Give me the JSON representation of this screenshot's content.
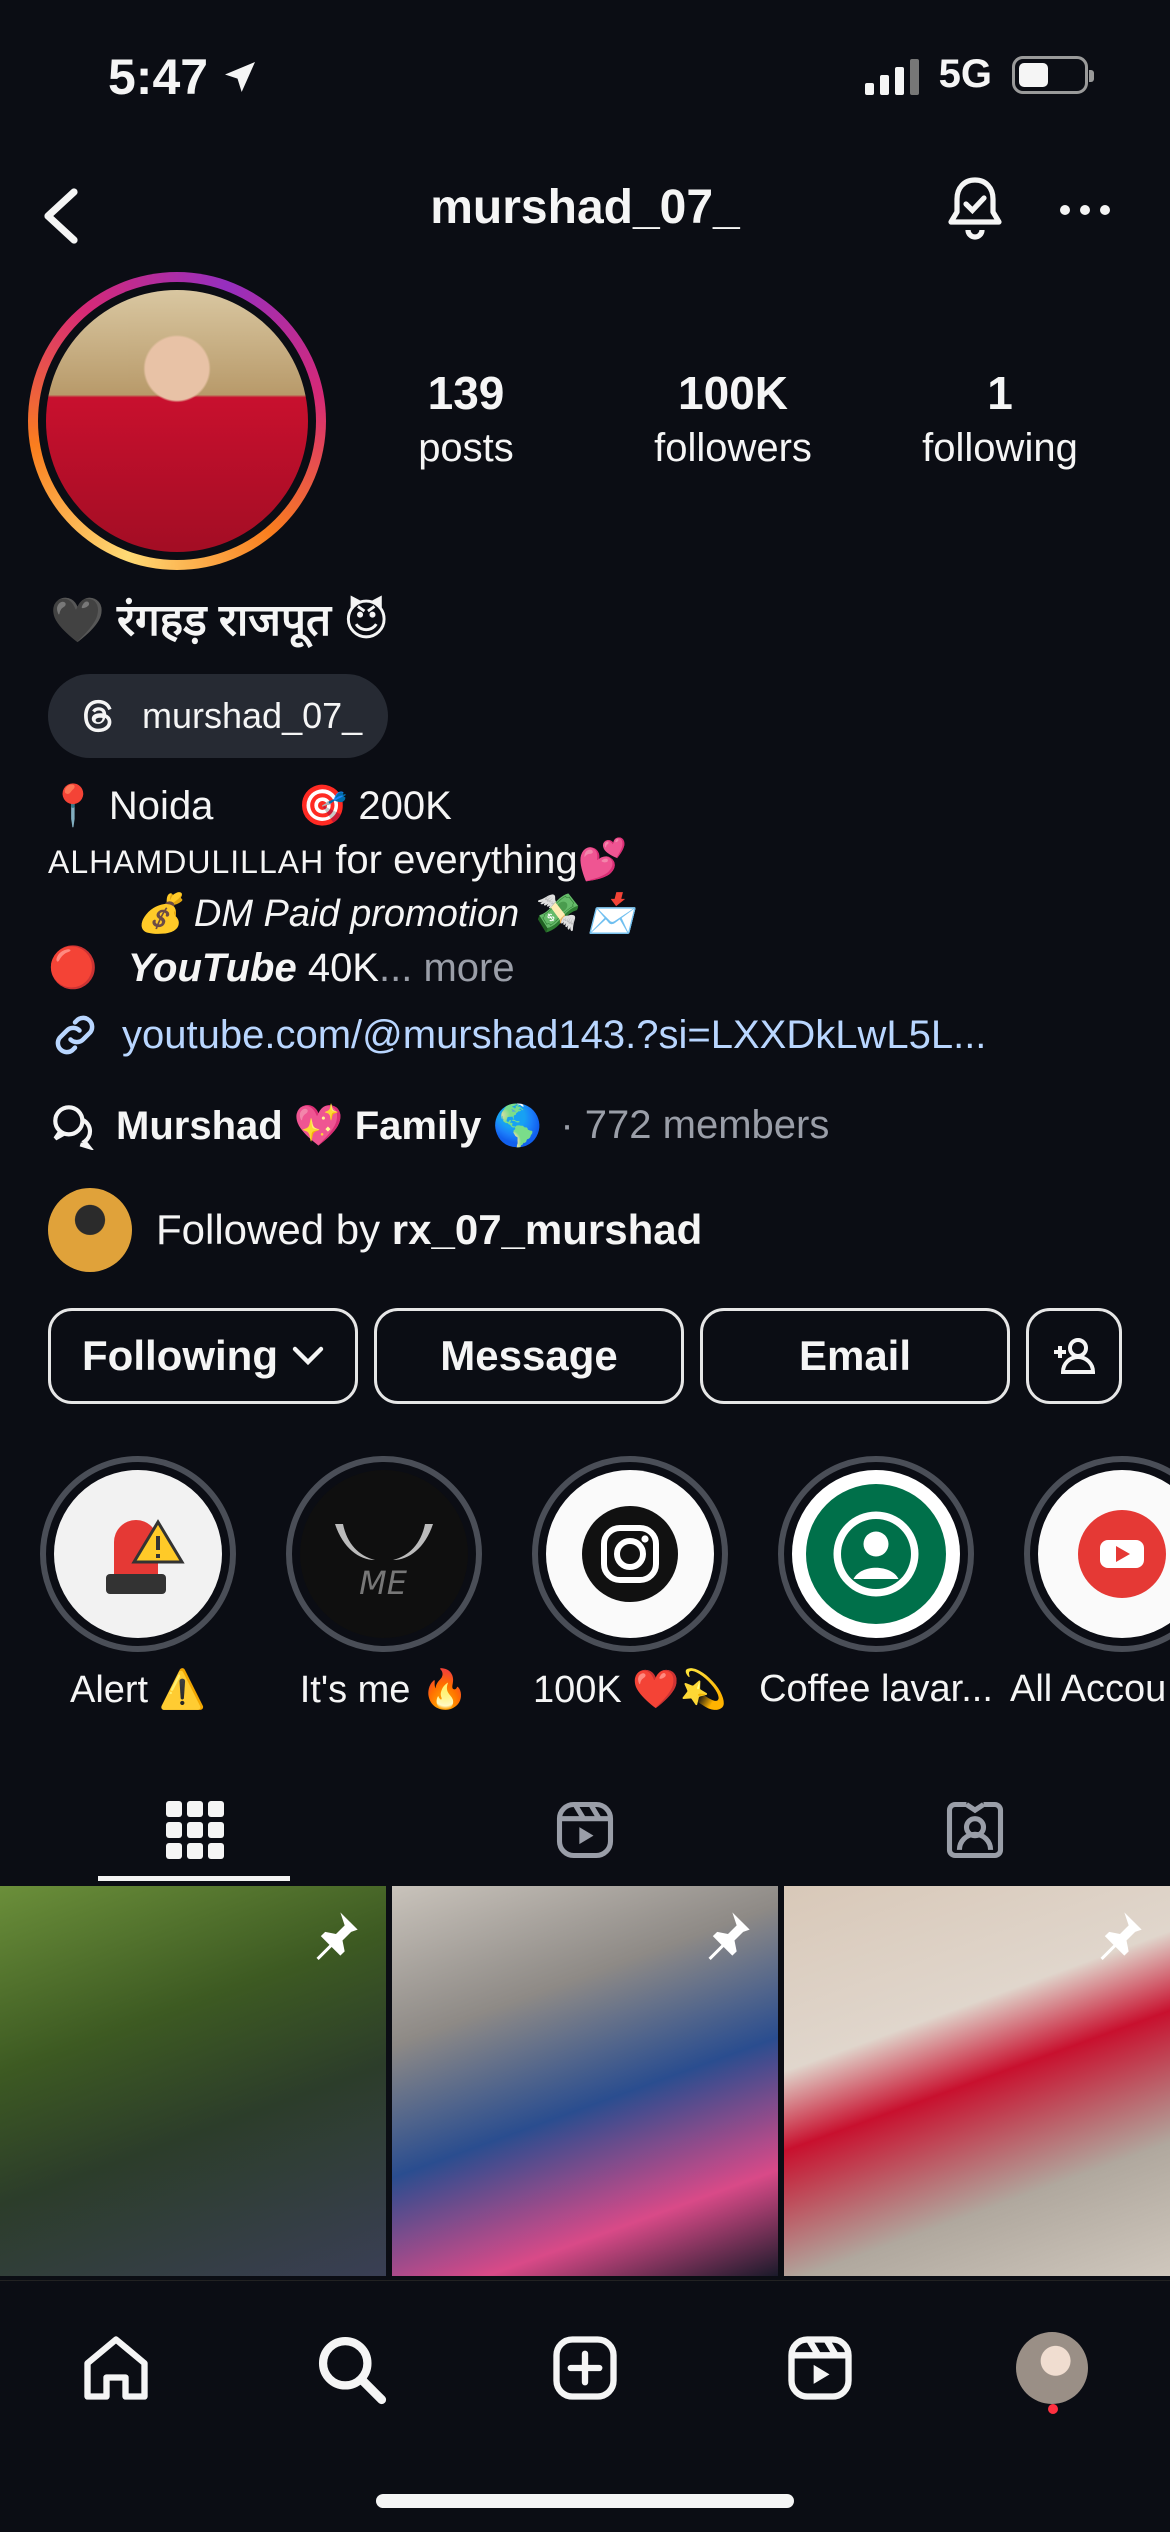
{
  "status_bar": {
    "time": "5:47",
    "network": "5G",
    "battery_level": 0.46
  },
  "header": {
    "username": "murshad_07_"
  },
  "stats": [
    {
      "number": "139",
      "label": "posts"
    },
    {
      "number": "100K",
      "label": "followers"
    },
    {
      "number": "1",
      "label": "following"
    }
  ],
  "profile": {
    "display_name": "🖤 रंगहड़ राजपूत 😈",
    "threads_handle": "murshad_07_",
    "bio_location": "📍 Noida",
    "bio_target": "🎯 200K",
    "bio_line2_caps": "ALHAMDULILLAH",
    "bio_line2_rest": " for everything💕",
    "bio_line3": "💰 DM Paid promotion 💸 📩",
    "bio_line4_dot": "🔴",
    "bio_line4_yt": "YouTube",
    "bio_line4_count": " 40K",
    "bio_line4_more": "... more",
    "link": "youtube.com/@murshad143.?si=LXXDkLwL5L...",
    "channel_name": "Murshad 💖 Family 🌎",
    "channel_members": "· 772 members",
    "followed_by_prefix": "Followed by ",
    "followed_by_user": "rx_07_murshad"
  },
  "actions": {
    "following": "Following",
    "message": "Message",
    "email": "Email"
  },
  "highlights": [
    {
      "label": "Alert ⚠️"
    },
    {
      "label": "It's me 🔥"
    },
    {
      "label": "100K ❤️💫"
    },
    {
      "label": "Coffee lavar..."
    },
    {
      "label": "All Accou"
    }
  ],
  "colors": {
    "background": "#0b0d14",
    "link": "#b9d6ff",
    "muted": "#9a9ea8",
    "notification_dot": "#ff3040"
  }
}
